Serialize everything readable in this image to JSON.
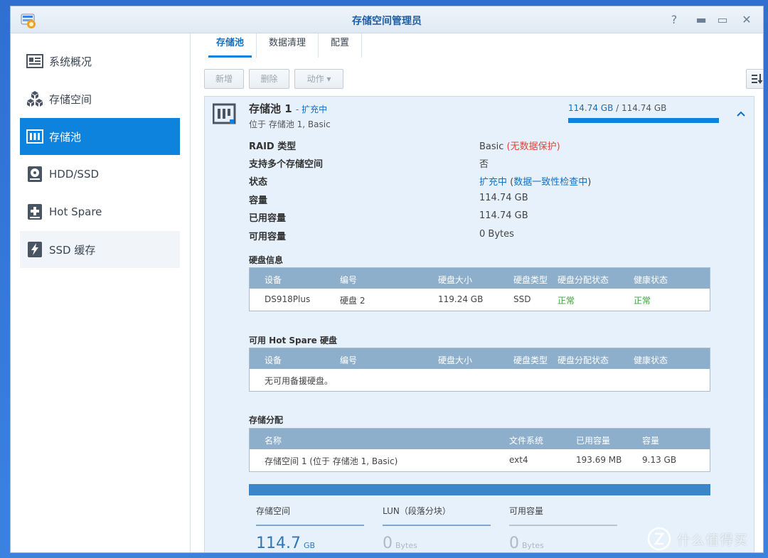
{
  "window": {
    "title": "存储空间管理员"
  },
  "sidebar": {
    "items": [
      {
        "label": "系统概况",
        "icon": "overview-icon"
      },
      {
        "label": "存储空间",
        "icon": "cubes-icon"
      },
      {
        "label": "存储池",
        "icon": "storage-pool-icon",
        "active": true
      },
      {
        "label": "HDD/SSD",
        "icon": "disk-icon"
      },
      {
        "label": "Hot Spare",
        "icon": "plus-box-icon"
      },
      {
        "label": "SSD 缓存",
        "icon": "lightning-icon"
      }
    ]
  },
  "tabs": [
    {
      "label": "存储池",
      "active": true
    },
    {
      "label": "数据清理"
    },
    {
      "label": "配置"
    }
  ],
  "toolbar": {
    "new_label": "新增",
    "delete_label": "删除",
    "action_label": "动作 ▾"
  },
  "pool": {
    "name": "存储池 1",
    "status_prefix": " - ",
    "status": "扩充中",
    "subtitle": "位于 存储池 1, Basic",
    "usage_used": "114.74 GB",
    "usage_sep": " / ",
    "usage_total": "114.74 GB",
    "usage_fraction": 1.0
  },
  "details": [
    {
      "key": "RAID 类型",
      "value": "Basic",
      "value_warn": " (无数据保护)"
    },
    {
      "key": "支持多个存储空间",
      "value": "否"
    },
    {
      "key": "状态",
      "value_link": "扩充中",
      "value_extra_open": " (",
      "value_link2": "数据一致性检查中",
      "value_extra_close": ")"
    },
    {
      "key": "容量",
      "value": "114.74 GB"
    },
    {
      "key": "已用容量",
      "value": "114.74 GB"
    },
    {
      "key": "可用容量",
      "value": "0 Bytes"
    }
  ],
  "disk_info": {
    "title": "硬盘信息",
    "headers": [
      "设备",
      "编号",
      "硬盘大小",
      "硬盘类型",
      "硬盘分配状态",
      "健康状态"
    ],
    "rows": [
      [
        "DS918Plus",
        "硬盘 2",
        "119.24 GB",
        "SSD",
        "正常",
        "正常"
      ]
    ]
  },
  "hot_spare": {
    "title": "可用 Hot Spare 硬盘",
    "headers": [
      "设备",
      "编号",
      "硬盘大小",
      "硬盘类型",
      "硬盘分配状态",
      "健康状态"
    ],
    "empty": "无可用备援硬盘。"
  },
  "allocation": {
    "title": "存储分配",
    "headers": [
      "名称",
      "文件系统",
      "已用容量",
      "容量"
    ],
    "rows": [
      [
        "存储空间 1 (位于 存储池 1, Basic)",
        "ext4",
        "193.69 MB",
        "9.13 GB"
      ]
    ]
  },
  "summary": [
    {
      "label": "存储空间",
      "value": "114.7",
      "unit": "GB"
    },
    {
      "label": "LUN（段落分块）",
      "value": "0",
      "unit": "Bytes"
    },
    {
      "label": "可用容量",
      "value": "0",
      "unit": "Bytes"
    }
  ],
  "watermark": {
    "text": "什么值得买",
    "logo": "zhi-logo"
  },
  "colors": {
    "accent": "#0e83dd",
    "ok": "#3aa339",
    "warn": "#e0463a",
    "table_header": "#8eafcc"
  }
}
